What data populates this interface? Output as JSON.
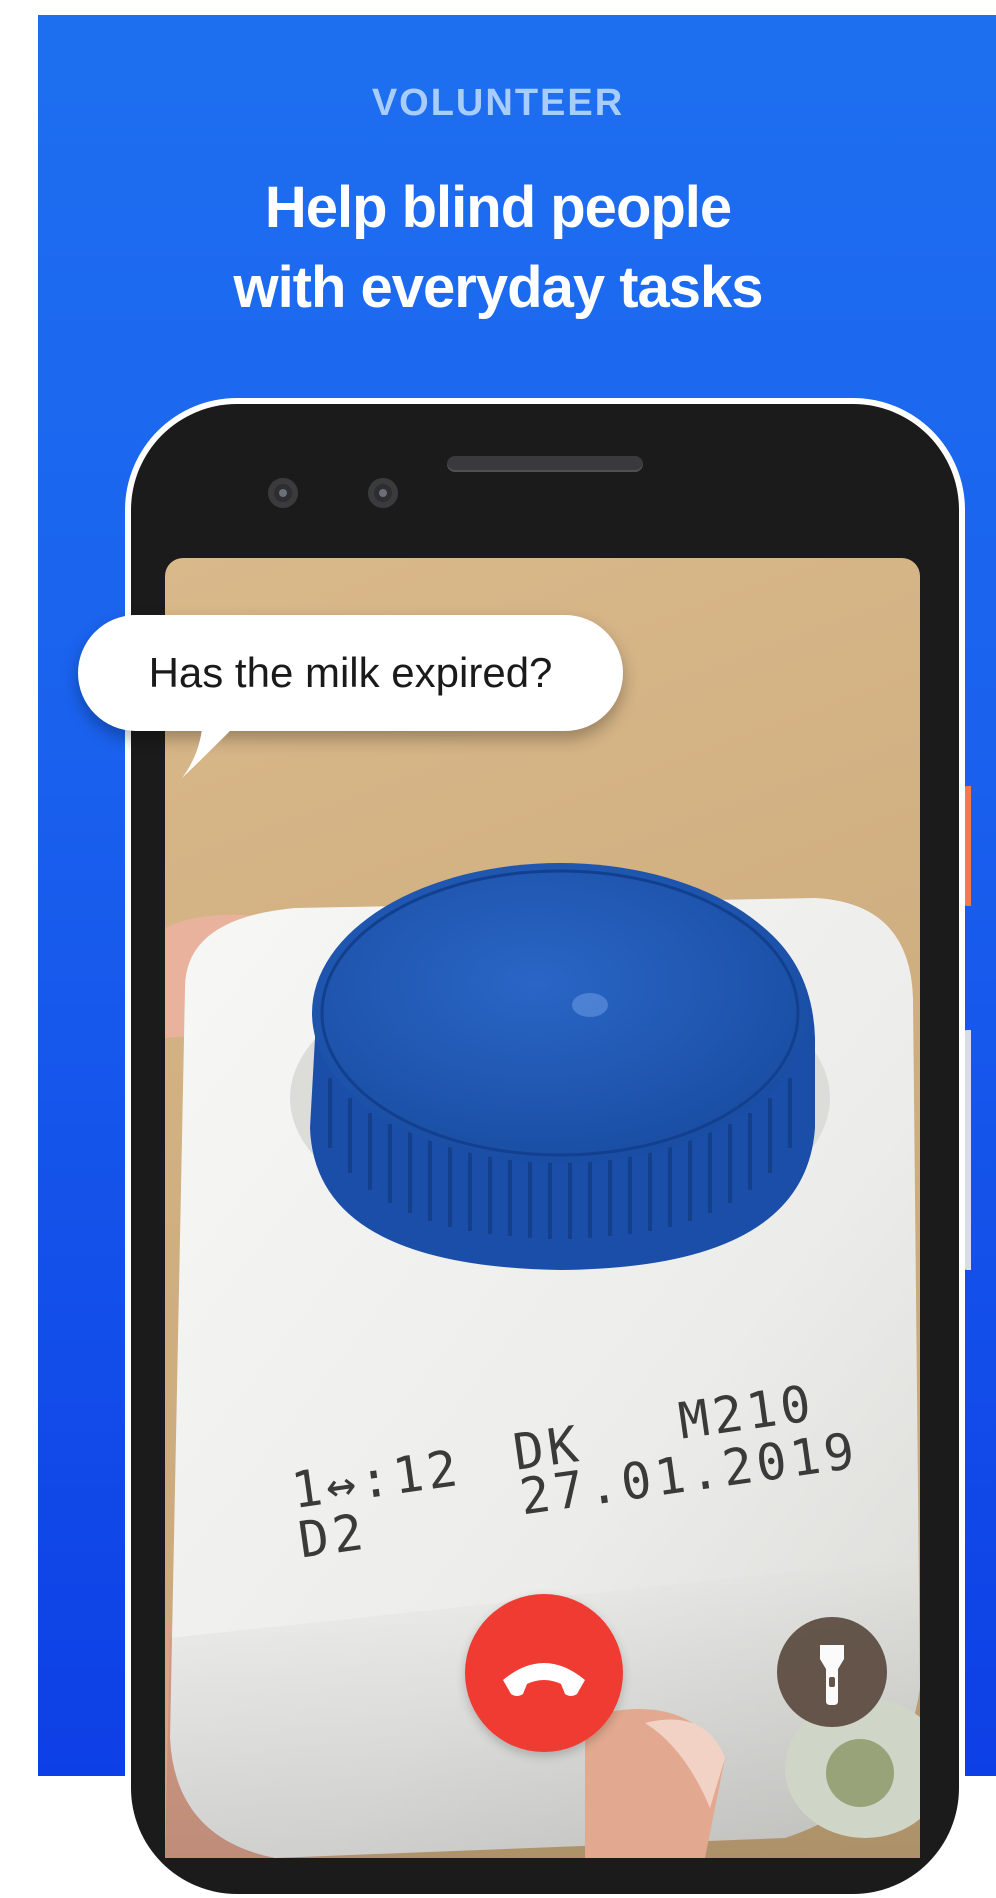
{
  "header": {
    "eyebrow": "VOLUNTEER",
    "title_line1": "Help blind people",
    "title_line2": "with everyday tasks"
  },
  "call": {
    "question": "Has the milk expired?",
    "end_call_icon": "phone-hangup-icon",
    "flashlight_icon": "flashlight-icon"
  },
  "camera_view": {
    "bottle_print": {
      "line1_left": "1↔:12",
      "line1_mid": "DK",
      "line1_right": "M210",
      "line2_left": "D2",
      "line2_right": "27.01.2019"
    }
  },
  "colors": {
    "background_top": "#1e6ff0",
    "background_bottom": "#0d3fe6",
    "eyebrow": "#a9cdfb",
    "end_call": "#f03b33",
    "cap_blue": "#1d55b4"
  }
}
